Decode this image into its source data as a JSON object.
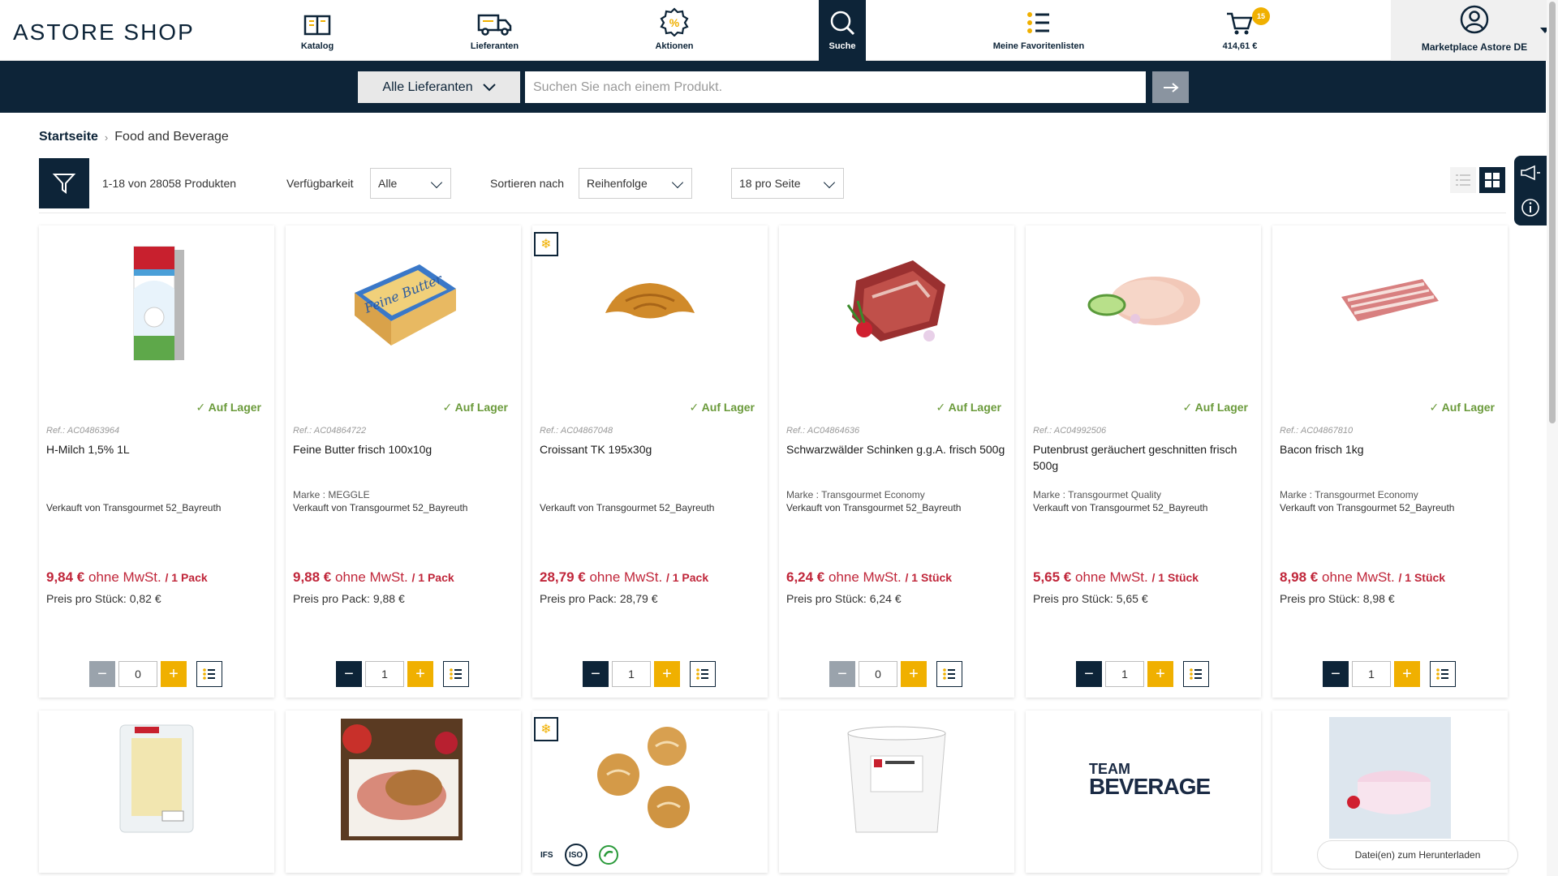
{
  "header": {
    "logo_text": "ASTORE SHOP",
    "nav": [
      {
        "label": "Katalog",
        "icon": "catalog-icon"
      },
      {
        "label": "Lieferanten",
        "icon": "truck-icon"
      },
      {
        "label": "Aktionen",
        "icon": "promo-badge-icon"
      },
      {
        "label": "Suche",
        "icon": "search-icon"
      },
      {
        "label": "Meine Favoritenlisten",
        "icon": "list-icon"
      }
    ],
    "cart": {
      "badge": "15",
      "total": "414,61 €"
    },
    "account_label": "Marketplace Astore DE"
  },
  "search": {
    "supplier_select": "Alle Lieferanten",
    "placeholder": "Suchen Sie nach einem Produkt.",
    "go_icon": "arrow-right-icon"
  },
  "breadcrumb": {
    "home": "Startseite",
    "current": "Food and Beverage"
  },
  "toolbar": {
    "result_count": "1-18 von 28058 Produkten",
    "availability_label": "Verfügbarkeit",
    "availability_value": "Alle",
    "sort_label": "Sortieren nach",
    "sort_value": "Reihenfolge",
    "per_page_value": "18 pro Seite"
  },
  "products": [
    {
      "stock": "Auf Lager",
      "ref": "Ref.: AC04863964",
      "name": "H-Milch 1,5% 1L",
      "brand": "",
      "seller": "Verkauft von Transgourmet 52_Bayreuth",
      "price": "9,84 €",
      "tax": " ohne MwSt. ",
      "unit": "/ 1 Pack",
      "unit_price": "Preis pro Stück: 0,82 €",
      "qty": "0"
    },
    {
      "stock": "Auf Lager",
      "ref": "Ref.: AC04864722",
      "name": "Feine Butter frisch 100x10g",
      "brand": "Marke : MEGGLE",
      "seller": "Verkauft von Transgourmet 52_Bayreuth",
      "price": "9,88 €",
      "tax": " ohne MwSt. ",
      "unit": "/ 1 Pack",
      "unit_price": "Preis pro Pack: 9,88 €",
      "qty": "1"
    },
    {
      "stock": "Auf Lager",
      "ref": "Ref.: AC04867048",
      "name": "Croissant TK 195x30g",
      "brand": "",
      "seller": "Verkauft von Transgourmet 52_Bayreuth",
      "price": "28,79 €",
      "tax": " ohne MwSt. ",
      "unit": "/ 1 Pack",
      "unit_price": "Preis pro Pack: 28,79 €",
      "qty": "1"
    },
    {
      "stock": "Auf Lager",
      "ref": "Ref.: AC04864636",
      "name": "Schwarzwälder Schinken g.g.A. frisch 500g",
      "brand": "Marke : Transgourmet Economy",
      "seller": "Verkauft von Transgourmet 52_Bayreuth",
      "price": "6,24 €",
      "tax": " ohne MwSt. ",
      "unit": "/ 1 Stück",
      "unit_price": "Preis pro Stück: 6,24 €",
      "qty": "0"
    },
    {
      "stock": "Auf Lager",
      "ref": "Ref.: AC04992506",
      "name": "Putenbrust geräuchert geschnitten frisch 500g",
      "brand": "Marke : Transgourmet Quality",
      "seller": "Verkauft von Transgourmet 52_Bayreuth",
      "price": "5,65 €",
      "tax": " ohne MwSt. ",
      "unit": "/ 1 Stück",
      "unit_price": "Preis pro Stück: 5,65 €",
      "qty": "1"
    },
    {
      "stock": "Auf Lager",
      "ref": "Ref.: AC04867810",
      "name": "Bacon frisch 1kg",
      "brand": "Marke : Transgourmet Economy",
      "seller": "Verkauft von Transgourmet 52_Bayreuth",
      "price": "8,98 €",
      "tax": " ohne MwSt. ",
      "unit": "/ 1 Stück",
      "unit_price": "Preis pro Stück: 8,98 €",
      "qty": "1"
    }
  ],
  "second_row": {
    "team_beverage_line1": "TEAM",
    "team_beverage_line2": "BEVERAGE",
    "certs": [
      "IFS",
      "ISO"
    ]
  },
  "download_label": "Datei(en) zum Herunterladen"
}
